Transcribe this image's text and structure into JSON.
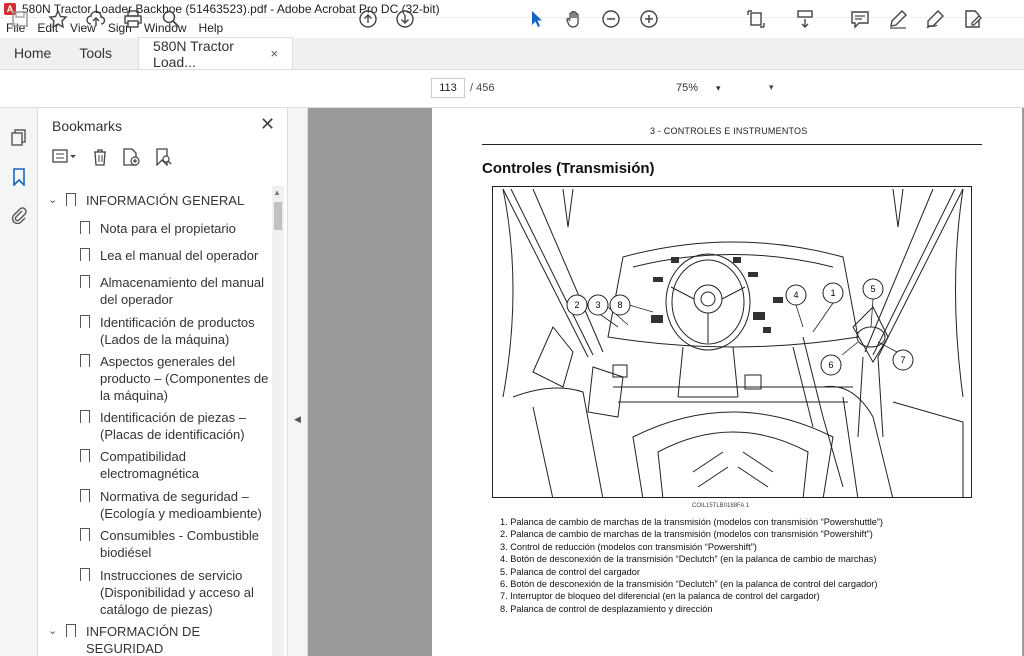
{
  "window": {
    "title": "580N Tractor Loader Backhoe (51463523).pdf - Adobe Acrobat Pro DC (32-bit)"
  },
  "menu": [
    "File",
    "Edit",
    "View",
    "Sign",
    "Window",
    "Help"
  ],
  "tabs": {
    "home": "Home",
    "tools": "Tools",
    "document": "580N Tractor Load...",
    "close": "×"
  },
  "toolbar": {
    "page_current": "113",
    "page_total": "/ 456",
    "zoom": "75%"
  },
  "bookmarks": {
    "title": "Bookmarks",
    "items": [
      {
        "label": "INFORMACIÓN GENERAL",
        "level": 0
      },
      {
        "label": "Nota para el propietario",
        "level": 1
      },
      {
        "label": "Lea el manual del operador",
        "level": 1
      },
      {
        "label": "Almacenamiento del manual del operador",
        "level": 1
      },
      {
        "label": "Identificación de productos (Lados de la máquina)",
        "level": 1
      },
      {
        "label": "Aspectos generales del producto – (Componentes de la máquina)",
        "level": 1
      },
      {
        "label": "Identificación de piezas – (Placas de identificación)",
        "level": 1
      },
      {
        "label": "Compatibilidad electromagnética",
        "level": 1
      },
      {
        "label": "Normativa de seguridad – (Ecología y medioambiente)",
        "level": 1
      },
      {
        "label": "Consumibles - Combustible biodiésel",
        "level": 1
      },
      {
        "label": "Instrucciones de servicio (Disponibilidad y acceso al catálogo de piezas)",
        "level": 1
      },
      {
        "label": "INFORMACIÓN DE SEGURIDAD",
        "level": 0
      }
    ]
  },
  "page": {
    "header": "3 - CONTROLES E INSTRUMENTOS",
    "section_title": "Controles (Transmisión)",
    "figure_code": "COIL15TLB0188FA   1",
    "callouts": [
      "1",
      "2",
      "3",
      "4",
      "5",
      "6",
      "7",
      "8"
    ],
    "captions": [
      "1.  Palanca de cambio de marchas de la transmisión (modelos con transmisión “Powershuttle”)",
      "2.  Palanca de cambio de marchas de la transmisión (modelos con transmisión “Powershift”)",
      "3.  Control de reducción (modelos con transmisión “Powershift”)",
      "4.  Botón de desconexión de la transmisión “Declutch” (en la palanca de cambio de marchas)",
      "5.  Palanca de control del cargador",
      "6.  Botón de desconexión de la transmisión “Declutch” (en la palanca de control del cargador)",
      "7.  Interruptor de bloqueo del diferencial (en la palanca de control del cargador)",
      "8.  Palanca de control de desplazamiento y dirección"
    ]
  }
}
